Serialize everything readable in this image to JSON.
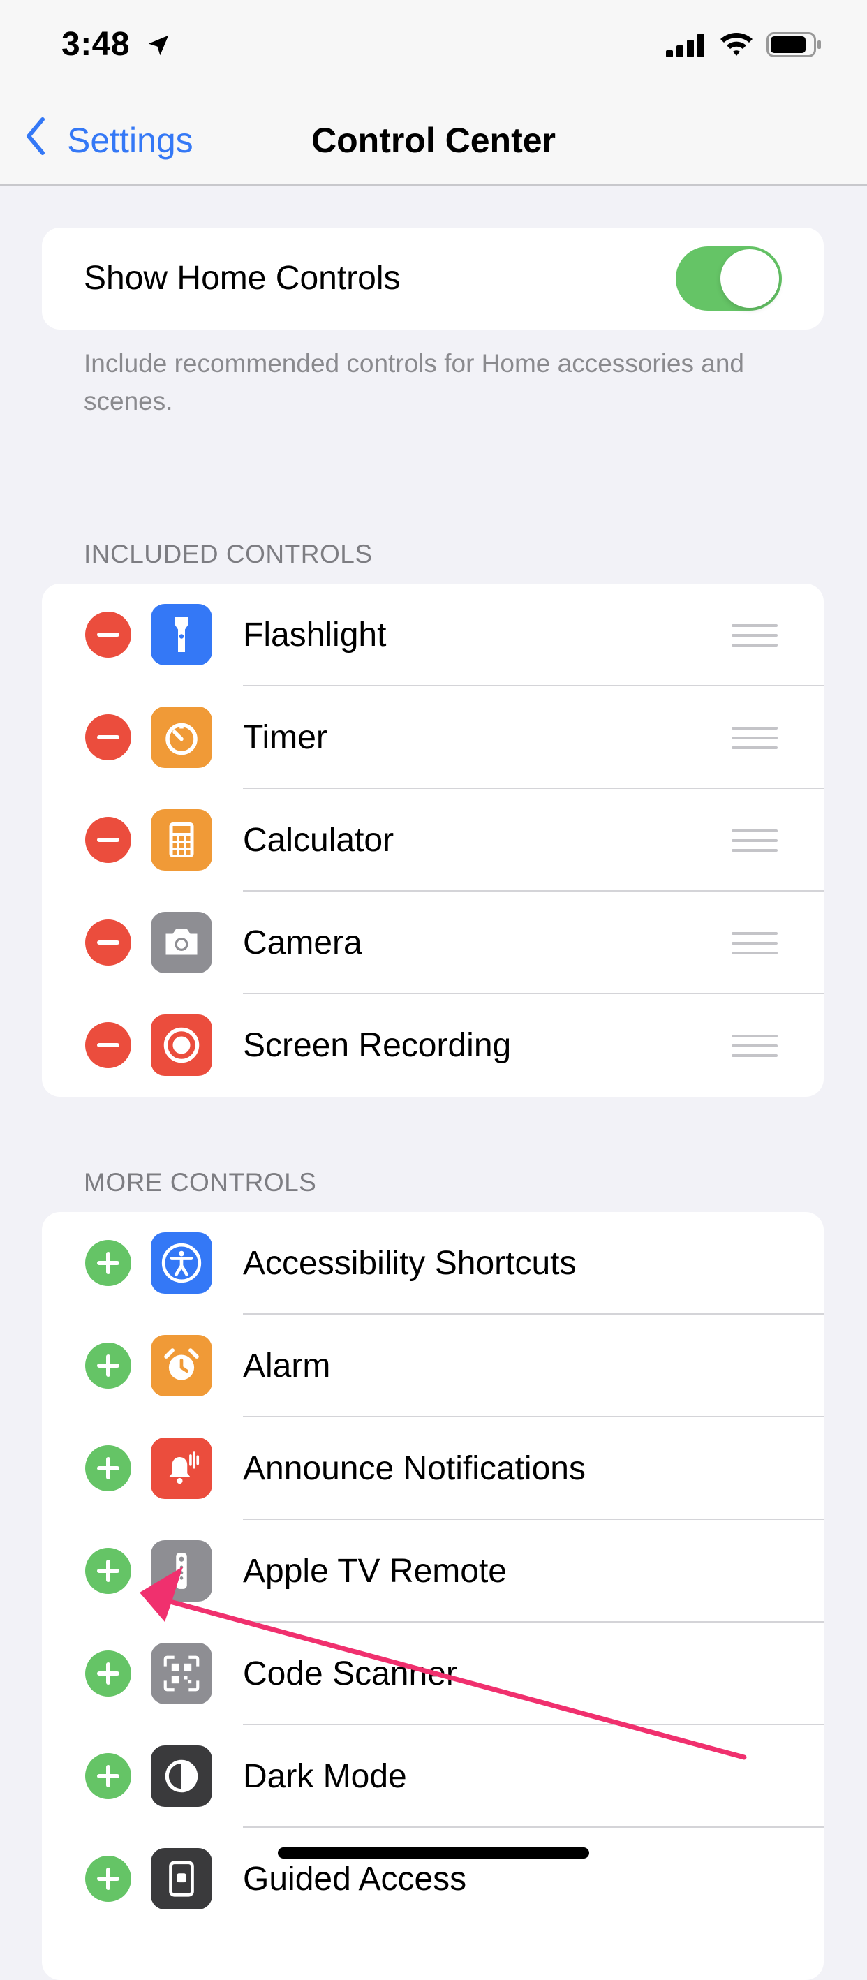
{
  "status_bar": {
    "time": "3:48"
  },
  "nav": {
    "back_label": "Settings",
    "title": "Control Center"
  },
  "home_controls": {
    "label": "Show Home Controls",
    "toggle_on": true,
    "footnote": "Include recommended controls for Home accessories and scenes."
  },
  "included": {
    "header": "INCLUDED CONTROLS",
    "items": [
      {
        "label": "Flashlight",
        "icon": "flashlight-icon",
        "color": "#3478f6"
      },
      {
        "label": "Timer",
        "icon": "timer-icon",
        "color": "#f09a37"
      },
      {
        "label": "Calculator",
        "icon": "calculator-icon",
        "color": "#f09a37"
      },
      {
        "label": "Camera",
        "icon": "camera-icon",
        "color": "#8e8e93"
      },
      {
        "label": "Screen Recording",
        "icon": "screen-recording-icon",
        "color": "#eb4d3d"
      }
    ]
  },
  "more": {
    "header": "MORE CONTROLS",
    "items": [
      {
        "label": "Accessibility Shortcuts",
        "icon": "accessibility-icon",
        "color": "#3478f6"
      },
      {
        "label": "Alarm",
        "icon": "alarm-icon",
        "color": "#f09a37"
      },
      {
        "label": "Announce Notifications",
        "icon": "announce-notifications-icon",
        "color": "#eb4d3d"
      },
      {
        "label": "Apple TV Remote",
        "icon": "apple-tv-remote-icon",
        "color": "#8e8e93"
      },
      {
        "label": "Code Scanner",
        "icon": "qr-code-icon",
        "color": "#8e8e93"
      },
      {
        "label": "Dark Mode",
        "icon": "dark-mode-icon",
        "color": "#3a3a3c"
      },
      {
        "label": "Guided Access",
        "icon": "guided-access-icon",
        "color": "#3a3a3c"
      }
    ]
  },
  "colors": {
    "accent": "#3478f6",
    "toggle_on": "#65c466",
    "remove": "#eb4d3d",
    "add": "#65c466",
    "annotation_arrow": "#f0306e"
  }
}
